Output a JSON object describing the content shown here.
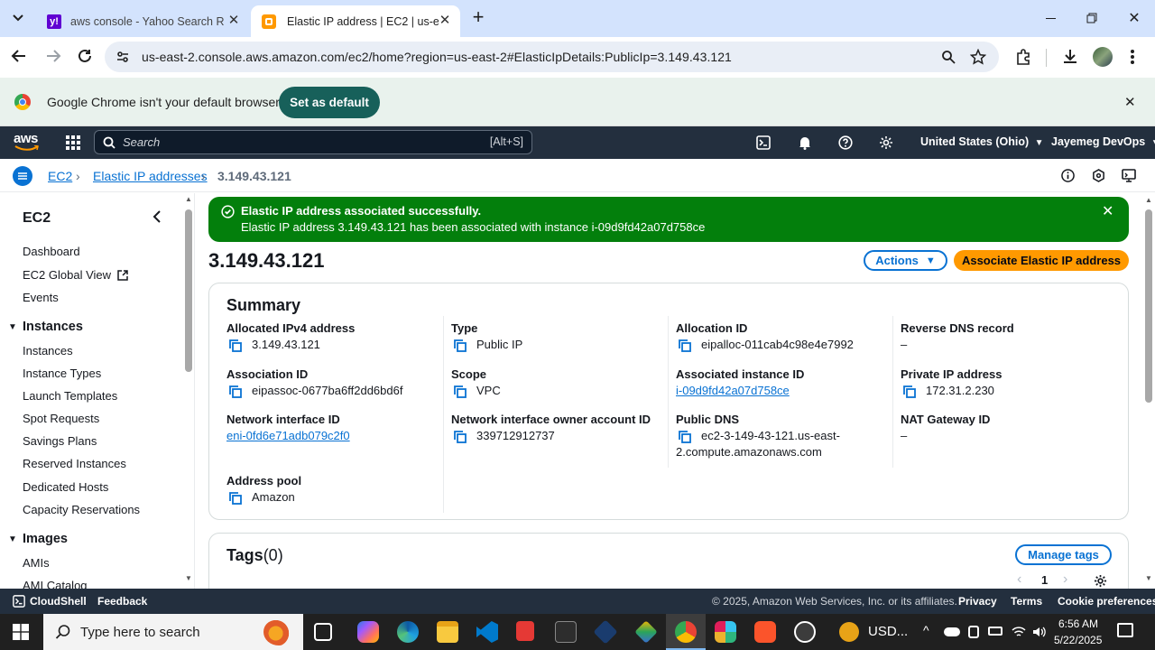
{
  "browser": {
    "tabs": [
      {
        "title": "aws console - Yahoo Search Re",
        "icon": "yahoo-icon"
      },
      {
        "title": "Elastic IP address | EC2 | us-east",
        "icon": "aws-icon"
      }
    ],
    "url": "us-east-2.console.aws.amazon.com/ec2/home?region=us-east-2#ElasticIpDetails:PublicIp=3.149.43.121"
  },
  "default_banner": {
    "text": "Google Chrome isn't your default browser",
    "button": "Set as default"
  },
  "aws_nav": {
    "logo": "aws",
    "search_placeholder": "Search",
    "search_shortcut": "[Alt+S]",
    "region": "United States (Ohio)",
    "account": "Jayemeg DevOps"
  },
  "breadcrumb": [
    "EC2",
    "Elastic IP addresses",
    "3.149.43.121"
  ],
  "sidebar": {
    "title": "EC2",
    "top_items": [
      "Dashboard",
      "EC2 Global View",
      "Events"
    ],
    "instances_header": "Instances",
    "instances_items": [
      "Instances",
      "Instance Types",
      "Launch Templates",
      "Spot Requests",
      "Savings Plans",
      "Reserved Instances",
      "Dedicated Hosts",
      "Capacity Reservations"
    ],
    "images_header": "Images",
    "images_items": [
      "AMIs",
      "AMI Catalog"
    ]
  },
  "flash": {
    "title": "Elastic IP address associated successfully.",
    "message": "Elastic IP address 3.149.43.121 has been associated with instance i-09d9fd42a07d758ce",
    "color": "#037f0c"
  },
  "page": {
    "title": "3.149.43.121",
    "actions_label": "Actions",
    "primary_label": "Associate Elastic IP address"
  },
  "summary": {
    "heading": "Summary",
    "col1": [
      {
        "label": "Allocated IPv4 address",
        "value": "3.149.43.121"
      },
      {
        "label": "Association ID",
        "value": "eipassoc-0677ba6ff2dd6bd6f"
      },
      {
        "label": "Network interface ID",
        "value": "eni-0fd6e71adb079c2f0"
      },
      {
        "label": "Address pool",
        "value": "Amazon"
      }
    ],
    "col2": [
      {
        "label": "Type",
        "value": "Public IP"
      },
      {
        "label": "Scope",
        "value": "VPC"
      },
      {
        "label": "Network interface owner account ID",
        "value": "339712912737"
      }
    ],
    "col3": [
      {
        "label": "Allocation ID",
        "value": "eipalloc-011cab4c98e4e7992"
      },
      {
        "label": "Associated instance ID",
        "value": "i-09d9fd42a07d758ce"
      },
      {
        "label": "Public DNS",
        "value_line1": "ec2-3-149-43-121.us-east-",
        "value_line2": "2.compute.amazonaws.com"
      }
    ],
    "col4": [
      {
        "label": "Reverse DNS record",
        "value": "–"
      },
      {
        "label": "Private IP address",
        "value": "172.31.2.230"
      },
      {
        "label": "NAT Gateway ID",
        "value": "–"
      }
    ]
  },
  "tags": {
    "heading": "Tags",
    "count": "(0)",
    "manage_label": "Manage tags",
    "page": "1"
  },
  "aws_footer": {
    "cloudshell": "CloudShell",
    "feedback": "Feedback",
    "copyright": "© 2025, Amazon Web Services, Inc. or its affiliates.",
    "privacy": "Privacy",
    "terms": "Terms",
    "cookies": "Cookie preferences"
  },
  "taskbar": {
    "search_placeholder": "Type here to search",
    "currency": "USD...",
    "time": "6:56 AM",
    "date": "5/22/2025"
  }
}
